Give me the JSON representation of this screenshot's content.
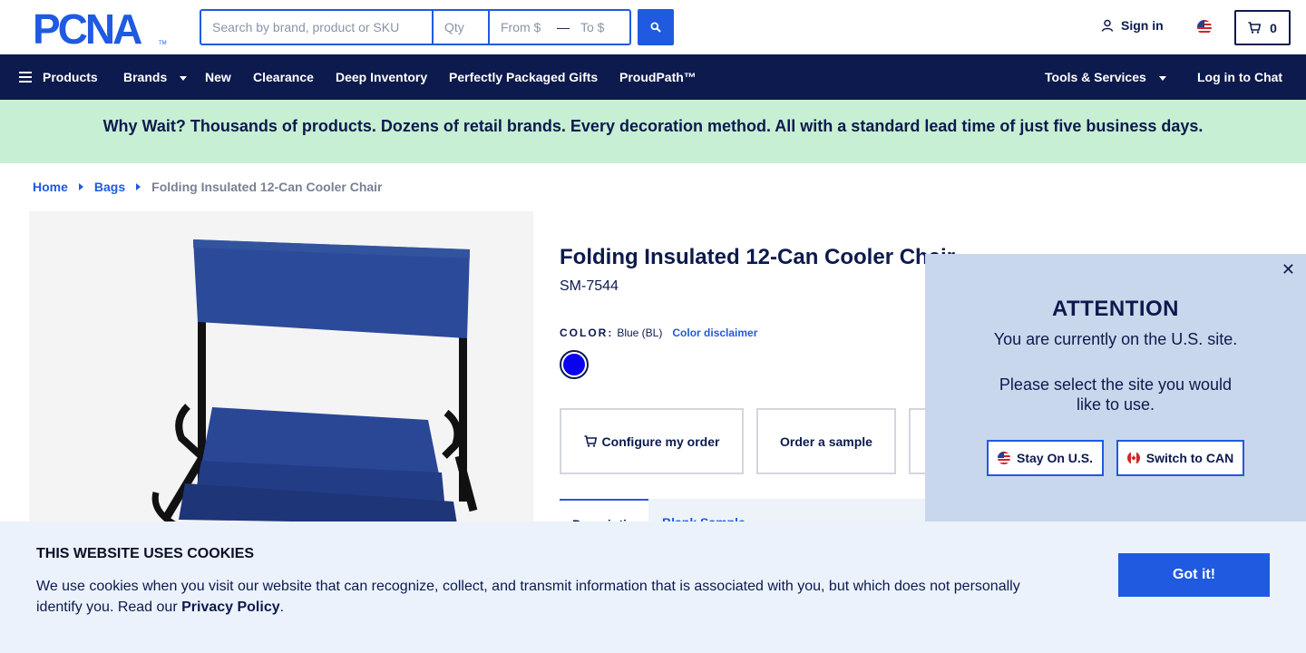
{
  "header": {
    "logo_text": "PCNA",
    "search_placeholder": "Search by brand, product or SKU",
    "qty_placeholder": "Qty",
    "price_from_placeholder": "From $",
    "price_dash": "—",
    "price_to_placeholder": "To $",
    "signin_label": "Sign in",
    "cart_count": "0"
  },
  "nav": {
    "products": "Products",
    "brands": "Brands",
    "new": "New",
    "clearance": "Clearance",
    "deep_inventory": "Deep Inventory",
    "gifts": "Perfectly Packaged Gifts",
    "proudpath": "ProudPath™",
    "tools": "Tools & Services",
    "chat": "Log in to Chat"
  },
  "banner": {
    "text": "Why Wait? Thousands of products. Dozens of retail brands. Every decoration method. All with a standard lead time of just five business days."
  },
  "breadcrumb": [
    "Home",
    "Bags",
    "Folding Insulated 12-Can Cooler Chair"
  ],
  "product": {
    "title": "Folding Insulated 12-Can Cooler Chair",
    "sku": "SM-7544",
    "color_label": "COLOR:",
    "color_value": "Blue (BL)",
    "color_disclaimer": "Color disclaimer",
    "swatch_color": "#0a00f2",
    "configure_label": "Configure my order",
    "sample_label": "Order a sample",
    "tabs": [
      "Description",
      "Blank Sample"
    ]
  },
  "attention": {
    "title": "ATTENTION",
    "line1": "You are currently on the U.S. site.",
    "line2": "Please select the site you would like to use.",
    "stay_label": "Stay On U.S.",
    "switch_label": "Switch to CAN"
  },
  "cookie": {
    "title": "THIS WEBSITE USES COOKIES",
    "text_before": "We use cookies when you visit our website that can recognize, collect, and transmit information that is associated with you, but which does not personally identify you. Read our ",
    "policy_link": "Privacy Policy",
    "text_after": ".",
    "button": "Got it!"
  },
  "colors": {
    "navy": "#0c1a4d",
    "accent_blue": "#1f5ae0",
    "banner_green": "#c7efd4",
    "popup_bg": "#c9d7ec",
    "cookie_bg": "#ebf2fb"
  }
}
